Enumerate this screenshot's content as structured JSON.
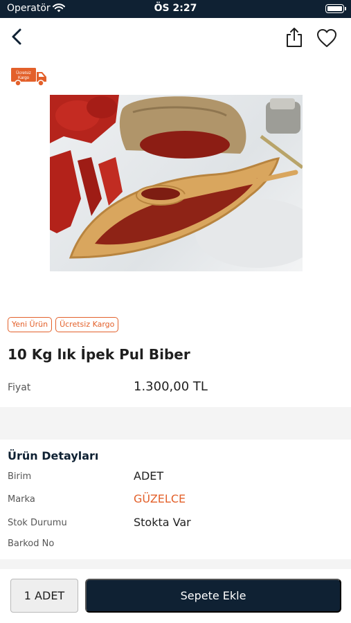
{
  "status_bar": {
    "carrier": "Operatör",
    "time": "ÖS 2:27"
  },
  "badge": {
    "line1": "Ücretsiz",
    "line2": "Kargo"
  },
  "tags": [
    "Yeni Ürün",
    "Ücretsiz Kargo"
  ],
  "product": {
    "title": "10 Kg lık İpek Pul Biber",
    "price_label": "Fiyat",
    "price_value": "1.300,00 TL"
  },
  "details": {
    "title": "Ürün Detayları",
    "rows": [
      {
        "label": "Birim",
        "value": "ADET"
      },
      {
        "label": "Marka",
        "value": "GÜZELCE"
      },
      {
        "label": "Stok Durumu",
        "value": "Stokta Var"
      },
      {
        "label": "Barkod No",
        "value": ""
      }
    ]
  },
  "bottom_bar": {
    "quantity_label": "1 ADET",
    "add_to_cart_label": "Sepete Ekle"
  },
  "colors": {
    "navy": "#0f2133",
    "accent": "#e3602a"
  },
  "icons": [
    "wifi-icon",
    "battery-icon",
    "back-chevron-icon",
    "share-icon",
    "heart-icon",
    "truck-icon"
  ]
}
